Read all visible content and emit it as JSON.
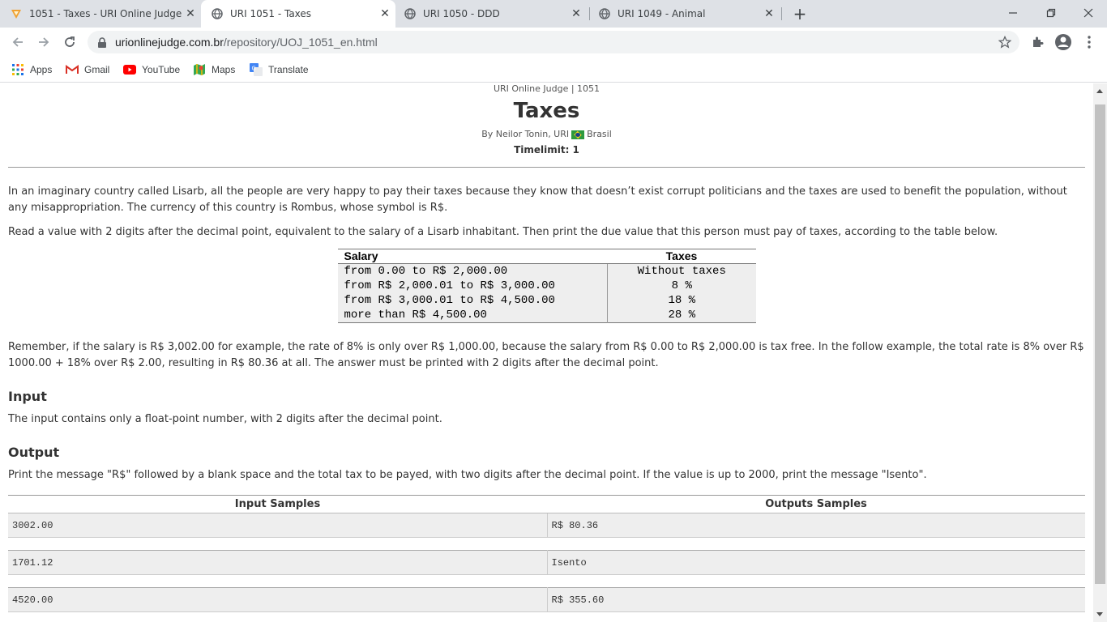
{
  "browser": {
    "tabs": [
      {
        "title": "1051 - Taxes - URI Online Judge",
        "icon": "uri-logo-icon",
        "active": false
      },
      {
        "title": "URI 1051 - Taxes",
        "icon": "globe-icon",
        "active": true
      },
      {
        "title": "URI 1050 - DDD",
        "icon": "globe-icon",
        "active": false
      },
      {
        "title": "URI 1049 - Animal",
        "icon": "globe-icon",
        "active": false
      }
    ],
    "url_host": "urionlinejudge.com.br",
    "url_path": "/repository/UOJ_1051_en.html",
    "bookmarks": [
      {
        "label": "Apps",
        "icon": "apps-grid-icon"
      },
      {
        "label": "Gmail",
        "icon": "gmail-icon"
      },
      {
        "label": "YouTube",
        "icon": "youtube-icon"
      },
      {
        "label": "Maps",
        "icon": "maps-icon"
      },
      {
        "label": "Translate",
        "icon": "translate-icon"
      }
    ],
    "colors": {
      "tabstrip": "#dee1e6",
      "omnibox": "#f1f3f4",
      "youtube": "#ff0000",
      "gmail": "#d93025"
    }
  },
  "problem": {
    "judge_line": "URI Online Judge | 1051",
    "title": "Taxes",
    "author_prefix": "By Neilor Tonin, URI",
    "author_country": "Brasil",
    "timelimit": "Timelimit: 1",
    "description_1": "In an imaginary country called Lisarb, all the people are very happy to pay their taxes because they know that doesn’t exist corrupt politicians and the taxes are used to benefit the population, without any misappropriation. The currency of this country is Rombus, whose symbol is R$.",
    "description_2": "Read a value with 2 digits after the decimal point, equivalent to the salary of a Lisarb inhabitant. Then print the due value that this person must pay of taxes, according to the table below.",
    "tax_table": {
      "headers": [
        "Salary",
        "Taxes"
      ],
      "rows": [
        [
          "from 0.00 to R$ 2,000.00",
          "Without taxes"
        ],
        [
          "from R$ 2,000.01 to R$ 3,000.00",
          "8 %"
        ],
        [
          "from R$ 3,000.01 to R$ 4,500.00",
          "18 %"
        ],
        [
          "more than R$ 4,500.00",
          "28 %"
        ]
      ]
    },
    "description_3": "Remember, if the salary is R$ 3,002.00 for example, the rate of 8% is only over R$ 1,000.00, because the salary from R$ 0.00 to R$ 2,000.00 is tax free. In the follow example, the total rate is 8% over R$ 1000.00 + 18% over R$ 2.00, resulting in R$ 80.36 at all. The answer must be printed with 2 digits after the decimal point.",
    "input_heading": "Input",
    "input_text": "The input contains only a float-point number, with 2 digits after the decimal point.",
    "output_heading": "Output",
    "output_text": "Print the message \"R$\" followed by a blank space and the total tax to be payed, with two digits after the decimal point. If the value is up to 2000, print the message \"Isento\".",
    "samples": {
      "headers": [
        "Input Samples",
        "Outputs Samples"
      ],
      "rows": [
        [
          "3002.00",
          "R$ 80.36"
        ],
        [
          "1701.12",
          "Isento"
        ],
        [
          "4520.00",
          "R$ 355.60"
        ]
      ]
    }
  }
}
